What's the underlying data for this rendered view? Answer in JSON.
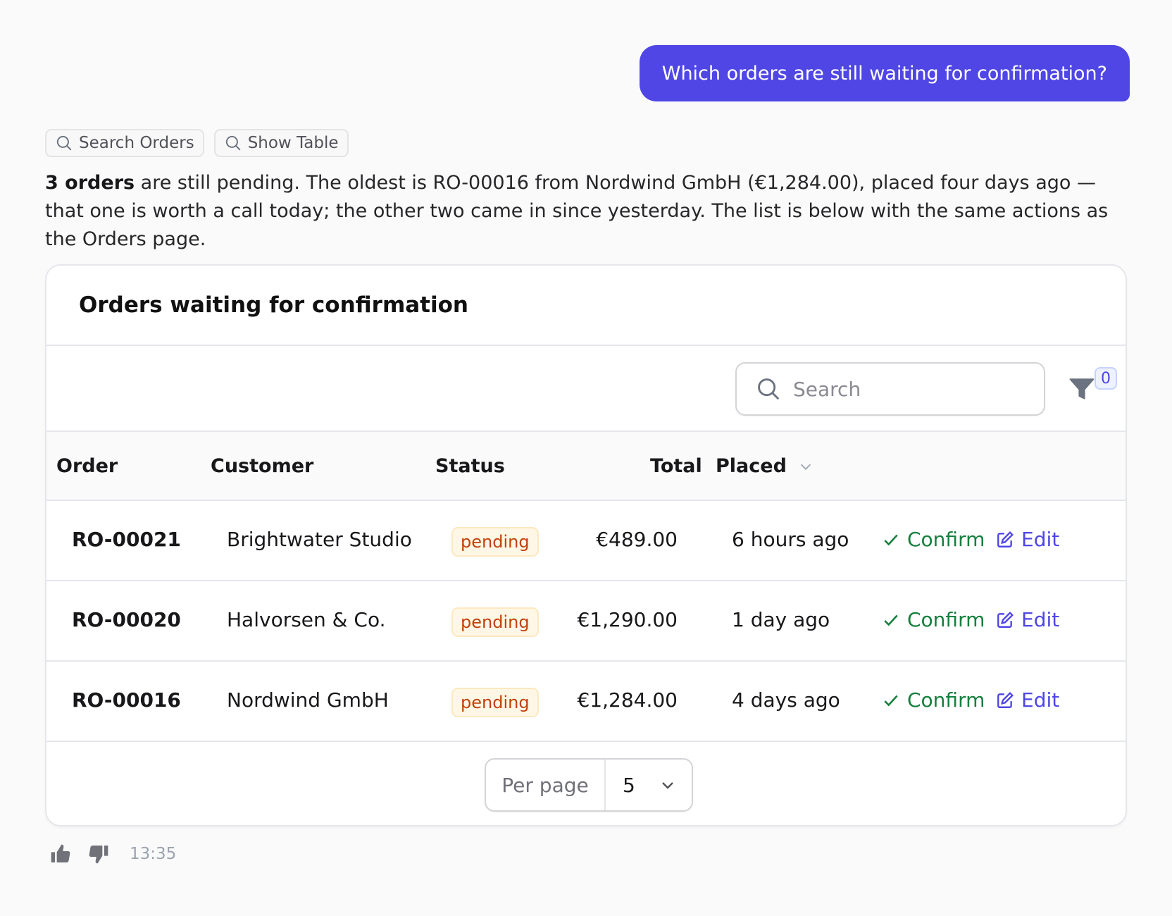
{
  "user_message": "Which orders are still waiting for confirmation?",
  "tool_chips": [
    {
      "label": "Search Orders",
      "icon": "search-icon"
    },
    {
      "label": "Show Table",
      "icon": "search-icon"
    }
  ],
  "assistant": {
    "bold_lead": "3 orders",
    "text": " are still pending. The oldest is RO-00016 from Nordwind GmbH (€1,284.00), placed four days ago — that one is worth a call today; the other two came in since yesterday. The list is below with the same actions as the Orders page."
  },
  "card": {
    "title": "Orders waiting for confirmation",
    "search_placeholder": "Search",
    "filter_count": "0",
    "columns": {
      "order": "Order",
      "customer": "Customer",
      "status": "Status",
      "total": "Total",
      "placed": "Placed"
    },
    "rows": [
      {
        "id": "RO-00021",
        "customer": "Brightwater Studio",
        "status": "pending",
        "total": "€489.00",
        "placed": "6 hours ago",
        "confirm": "Confirm",
        "edit": "Edit"
      },
      {
        "id": "RO-00020",
        "customer": "Halvorsen & Co.",
        "status": "pending",
        "total": "€1,290.00",
        "placed": "1 day ago",
        "confirm": "Confirm",
        "edit": "Edit"
      },
      {
        "id": "RO-00016",
        "customer": "Nordwind GmbH",
        "status": "pending",
        "total": "€1,284.00",
        "placed": "4 days ago",
        "confirm": "Confirm",
        "edit": "Edit"
      }
    ],
    "per_page_label": "Per page",
    "per_page_value": "5"
  },
  "timestamp": "13:35",
  "colors": {
    "accent": "#4f46e5",
    "confirm": "#15803d",
    "pending_text": "#c2410c",
    "pending_bg": "#fff7e6"
  }
}
